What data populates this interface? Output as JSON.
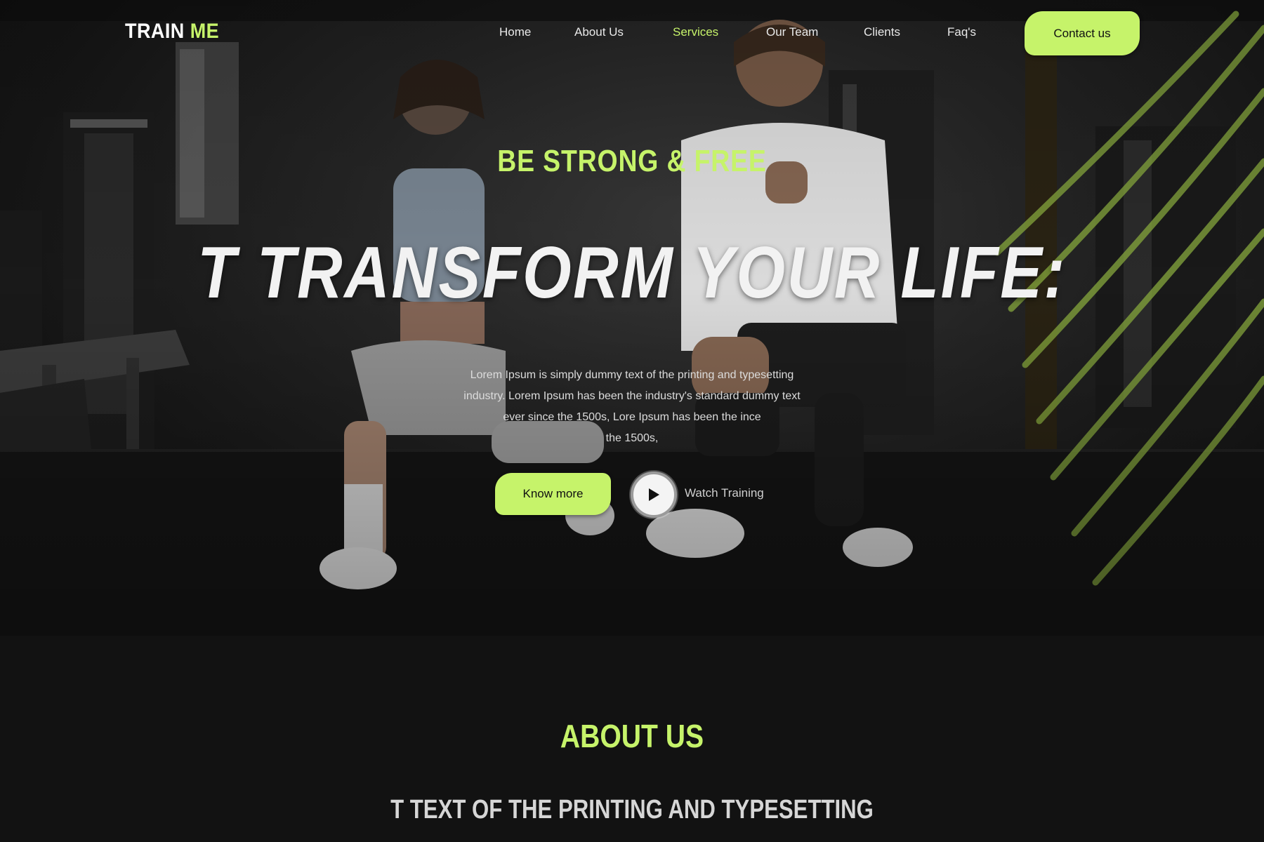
{
  "brand": {
    "logo_part1": "TRAIN",
    "logo_part2": "ME",
    "accent_color": "#c6f36a",
    "background_color": "#121212"
  },
  "nav": {
    "links": [
      {
        "label": "Home",
        "active": false
      },
      {
        "label": "About Us",
        "active": false
      },
      {
        "label": "Services",
        "active": true
      },
      {
        "label": "Our Team",
        "active": false
      },
      {
        "label": "Clients",
        "active": false
      },
      {
        "label": "Faq's",
        "active": false
      }
    ],
    "contact_label": "Contact us"
  },
  "hero": {
    "eyebrow": "BE STRONG & FREE",
    "headline": "T TRANSFORM YOUR LIFE:",
    "body_lines": [
      "Lorem Ipsum is simply dummy text of the printing and typesetting",
      "industry. Lorem Ipsum has been the industry's standard dummy text",
      "ever since the 1500s, Lore Ipsum has been the ince",
      "the 1500s,"
    ],
    "primary_button": "Know more",
    "play_icon": "play-icon",
    "secondary_label": "Watch Training"
  },
  "about": {
    "heading": "ABOUT US",
    "subheading": "T TEXT OF THE PRINTING AND TYPESETTING"
  }
}
